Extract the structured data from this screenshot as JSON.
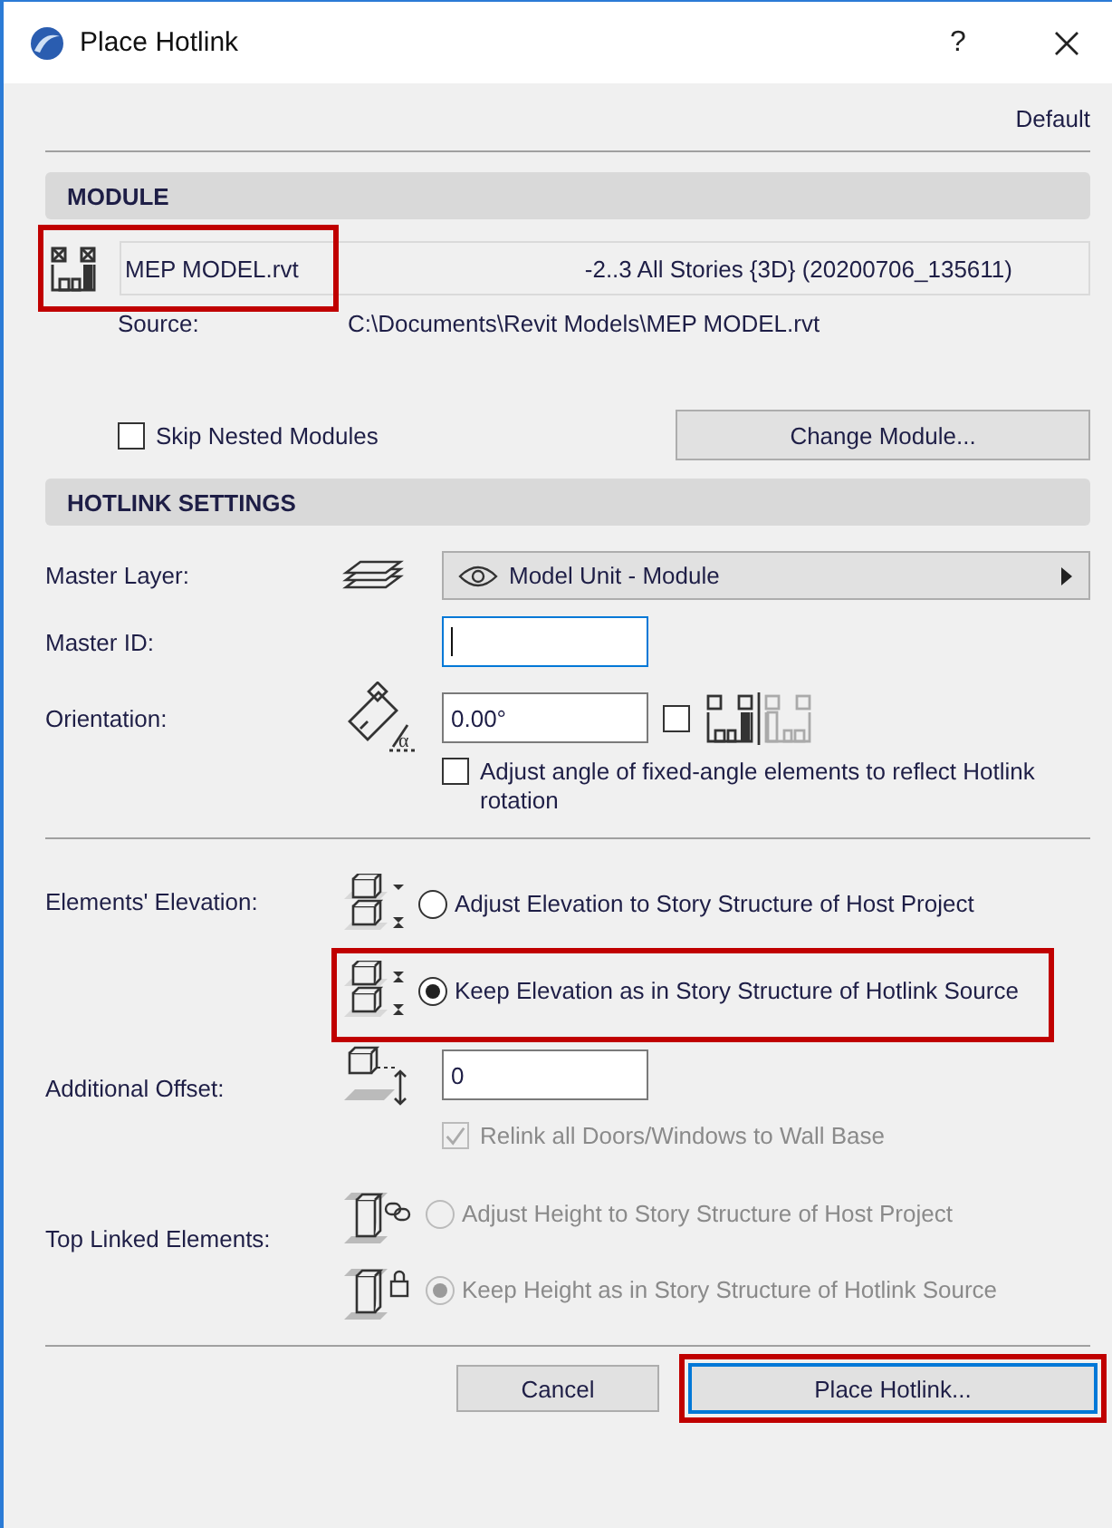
{
  "window": {
    "title": "Place Hotlink",
    "help": "?"
  },
  "preset": "Default",
  "module": {
    "heading": "MODULE",
    "name": "MEP MODEL.rvt",
    "highlighted": true,
    "stories": "-2..3 All Stories {3D} (20200706_135611)",
    "source_label": "Source:",
    "source": "C:\\Documents\\Revit Models\\MEP MODEL.rvt",
    "skip_nested": {
      "label": "Skip Nested Modules",
      "checked": false
    },
    "change_button": "Change Module..."
  },
  "settings": {
    "heading": "HOTLINK SETTINGS",
    "master_layer": {
      "label": "Master Layer:",
      "value": "Model Unit - Module"
    },
    "master_id": {
      "label": "Master ID:",
      "focused": true
    },
    "orientation": {
      "label": "Orientation:",
      "value": "0.00°",
      "angle_symbol": "α",
      "mirror_checked": false
    },
    "adjust_angle": {
      "label": "Adjust angle of fixed-angle elements to reflect Hotlink rotation",
      "checked": false
    },
    "elevation": {
      "label": "Elements' Elevation:",
      "options": [
        {
          "label": "Adjust Elevation to Story Structure of Host Project",
          "selected": false,
          "highlighted": false
        },
        {
          "label": "Keep Elevation as in Story Structure of Hotlink Source",
          "selected": true,
          "highlighted": true
        }
      ]
    },
    "additional_offset": {
      "label": "Additional Offset:",
      "value": "0"
    },
    "relink": {
      "label": "Relink all Doors/Windows to Wall Base",
      "checked": true,
      "disabled": true
    },
    "top_linked": {
      "label": "Top Linked Elements:",
      "disabled": true,
      "options": [
        {
          "label": "Adjust Height to Story Structure of Host Project",
          "selected": false
        },
        {
          "label": "Keep Height as in Story Structure of Hotlink Source",
          "selected": true
        }
      ]
    }
  },
  "buttons": [
    {
      "label": "Cancel",
      "default": false,
      "highlighted": false
    },
    {
      "label": "Place Hotlink...",
      "default": true,
      "highlighted": true
    }
  ]
}
